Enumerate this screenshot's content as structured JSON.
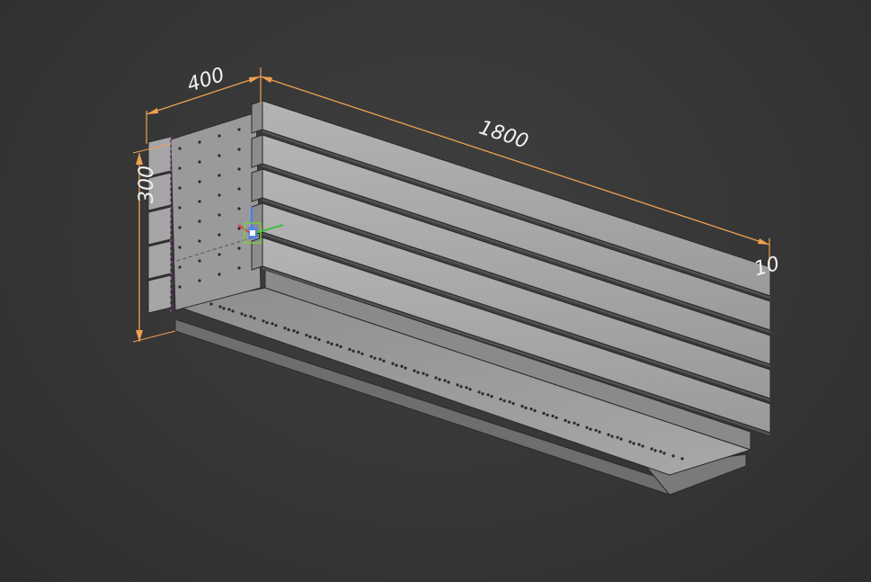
{
  "model_view": {
    "background_color": "#3a3a3a",
    "dimension_color": "#f0a050",
    "dimension_text_color": "#f2f2f2",
    "panel_color": "#9e9e9e",
    "dimensions": {
      "width_label": "400",
      "length_label": "1800",
      "height_label": "300",
      "far_label": "10"
    },
    "origin_gizmo": {
      "x_axis_color": "#e04040",
      "y_axis_color": "#40c040",
      "z_axis_color": "#4080ff",
      "icon": "coordinate-system-icon"
    }
  }
}
